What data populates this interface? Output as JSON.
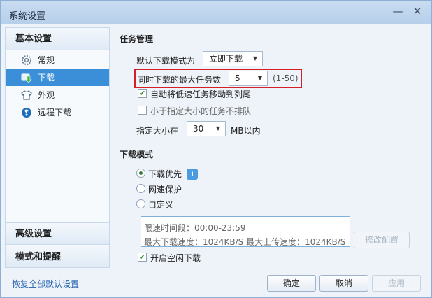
{
  "window": {
    "title": "系统设置",
    "minimize": "—",
    "close": "✕"
  },
  "sidebar": {
    "basic_header": "基本设置",
    "items": [
      {
        "label": "常规",
        "icon": "gear-icon"
      },
      {
        "label": "下载",
        "icon": "download-icon",
        "active": true
      },
      {
        "label": "外观",
        "icon": "shirt-icon"
      },
      {
        "label": "远程下载",
        "icon": "remote-download-icon"
      }
    ],
    "advanced_header": "高级设置",
    "mode_header": "模式和提醒"
  },
  "restore_link": "恢复全部默认设置",
  "task_management": {
    "title": "任务管理",
    "default_mode_label": "默认下载模式为",
    "default_mode_value": "立即下载",
    "max_tasks_label": "同时下载的最大任务数",
    "max_tasks_value": "5",
    "max_tasks_range": "(1-50)",
    "move_slow_to_end": {
      "label": "自动将低速任务移动到列尾",
      "checked": true
    },
    "no_queue_small": {
      "label": "小于指定大小的任务不排队",
      "checked": false
    },
    "size_label": "指定大小在",
    "size_value": "30",
    "size_unit": "MB以内"
  },
  "download_mode": {
    "title": "下载模式",
    "options": [
      {
        "label": "下载优先",
        "selected": true
      },
      {
        "label": "网速保护",
        "selected": false
      },
      {
        "label": "自定义",
        "selected": false
      }
    ],
    "info_icon": "i",
    "limit_time": "限速时间段：00:00-23:59",
    "limit_speeds": "最大下载速度：1024KB/S  最大上传速度：1024KB/S",
    "modify_config": "修改配置",
    "idle_download": {
      "label": "开启空闲下载",
      "checked": true
    }
  },
  "buttons": {
    "ok": "确定",
    "cancel": "取消",
    "apply": "应用"
  },
  "colors": {
    "accent": "#3a8fd8",
    "highlight": "#d51f26",
    "link": "#1f5fae"
  }
}
